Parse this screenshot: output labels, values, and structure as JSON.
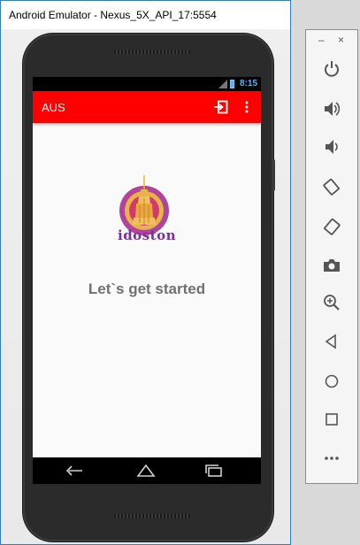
{
  "window": {
    "title": "Android Emulator - Nexus_5X_API_17:5554"
  },
  "statusbar": {
    "time": "8:15"
  },
  "appbar": {
    "title": "AUS",
    "color": "#fe0000"
  },
  "content": {
    "logo_text": "idoston",
    "headline": "Let`s get started"
  },
  "toolbar": {
    "minimize": "–",
    "close": "×",
    "buttons": [
      {
        "icon": "power-icon"
      },
      {
        "icon": "volume-up-icon"
      },
      {
        "icon": "volume-down-icon"
      },
      {
        "icon": "rotate-left-icon"
      },
      {
        "icon": "rotate-right-icon"
      },
      {
        "icon": "camera-icon"
      },
      {
        "icon": "zoom-icon"
      },
      {
        "icon": "back-icon"
      },
      {
        "icon": "home-icon"
      },
      {
        "icon": "overview-icon"
      },
      {
        "icon": "more-icon"
      }
    ]
  }
}
